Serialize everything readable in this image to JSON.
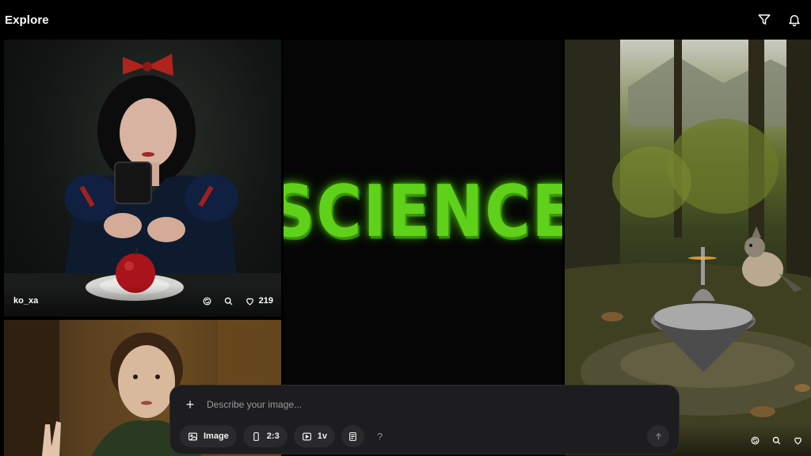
{
  "header": {
    "title": "Explore",
    "filter_icon": "filter-icon",
    "notification_icon": "bell-icon"
  },
  "feed": {
    "tiles": [
      {
        "id": "snow",
        "author": "ko_xa",
        "likes": "219",
        "icons": [
          "remix-icon",
          "search-icon",
          "heart-icon"
        ]
      },
      {
        "id": "science",
        "artwork_text": "SCIENCE"
      },
      {
        "id": "forest",
        "icons": [
          "remix-icon",
          "search-icon",
          "heart-icon"
        ]
      },
      {
        "id": "portrait"
      }
    ]
  },
  "prompt": {
    "placeholder": "Describe your image...",
    "add_icon": "plus-icon",
    "mode_label": "Image",
    "aspect_label": "2:3",
    "version_label": "1v",
    "help_label": "?",
    "send_icon": "arrow-up-icon"
  },
  "colors": {
    "background": "#000000",
    "prompt_bg": "#1d1d1f",
    "chip_bg": "#2a2a2c",
    "slime_green": "#5fd11a"
  }
}
